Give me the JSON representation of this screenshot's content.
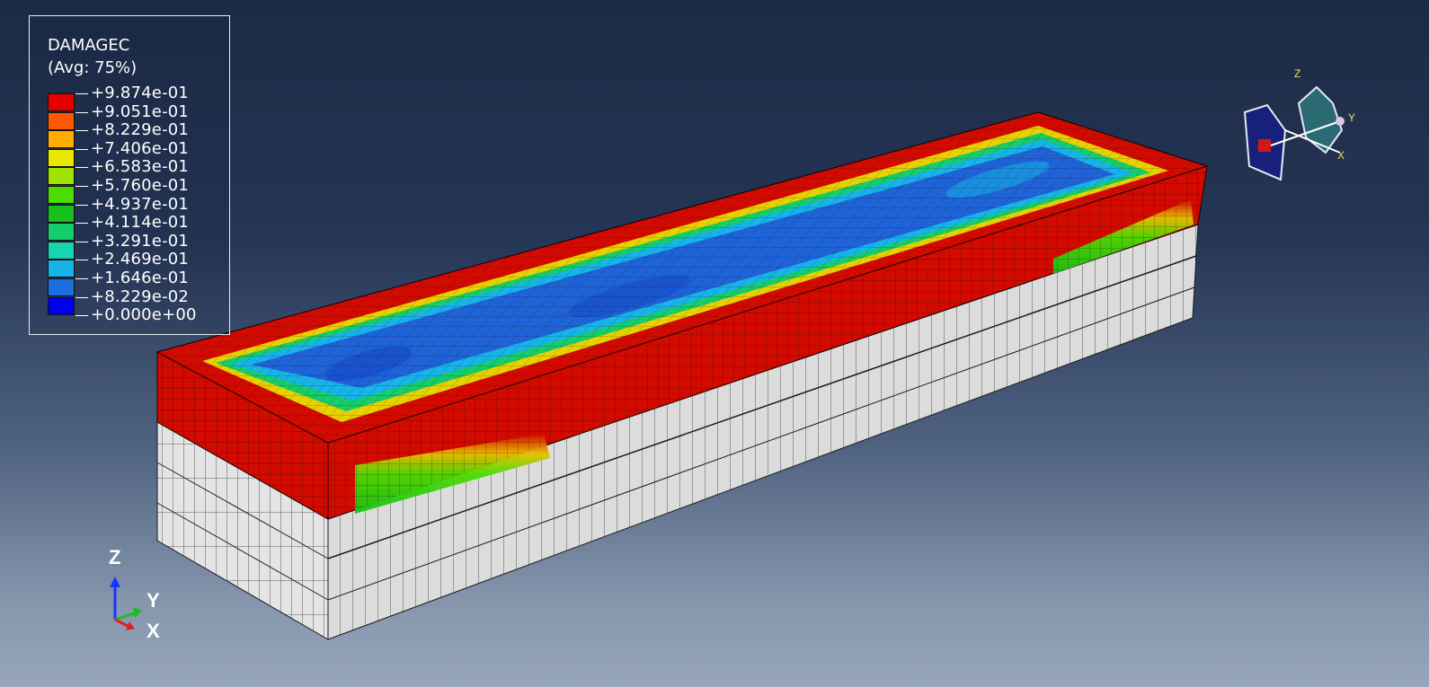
{
  "legend": {
    "title": "DAMAGEC",
    "subtitle": "(Avg: 75%)",
    "values": [
      "+9.874e-01",
      "+9.051e-01",
      "+8.229e-01",
      "+7.406e-01",
      "+6.583e-01",
      "+5.760e-01",
      "+4.937e-01",
      "+4.114e-01",
      "+3.291e-01",
      "+2.469e-01",
      "+1.646e-01",
      "+8.229e-02",
      "+0.000e+00"
    ],
    "colors": [
      "#e80000",
      "#ff5a00",
      "#ffae00",
      "#e8e800",
      "#9fe400",
      "#4cdc00",
      "#16c21a",
      "#17cc6a",
      "#16d6b2",
      "#16b4e8",
      "#1d6fe0",
      "#1840d8",
      "#0000f0"
    ]
  },
  "triad": {
    "z": "Z",
    "y": "Y",
    "x": "X"
  },
  "view_cube": {
    "z": "Z",
    "y": "Y",
    "x": "X"
  },
  "colors": {
    "damage_high": "#d20a00",
    "concrete_grey": "#e3e3e3",
    "mesh_line": "#1a0505"
  }
}
